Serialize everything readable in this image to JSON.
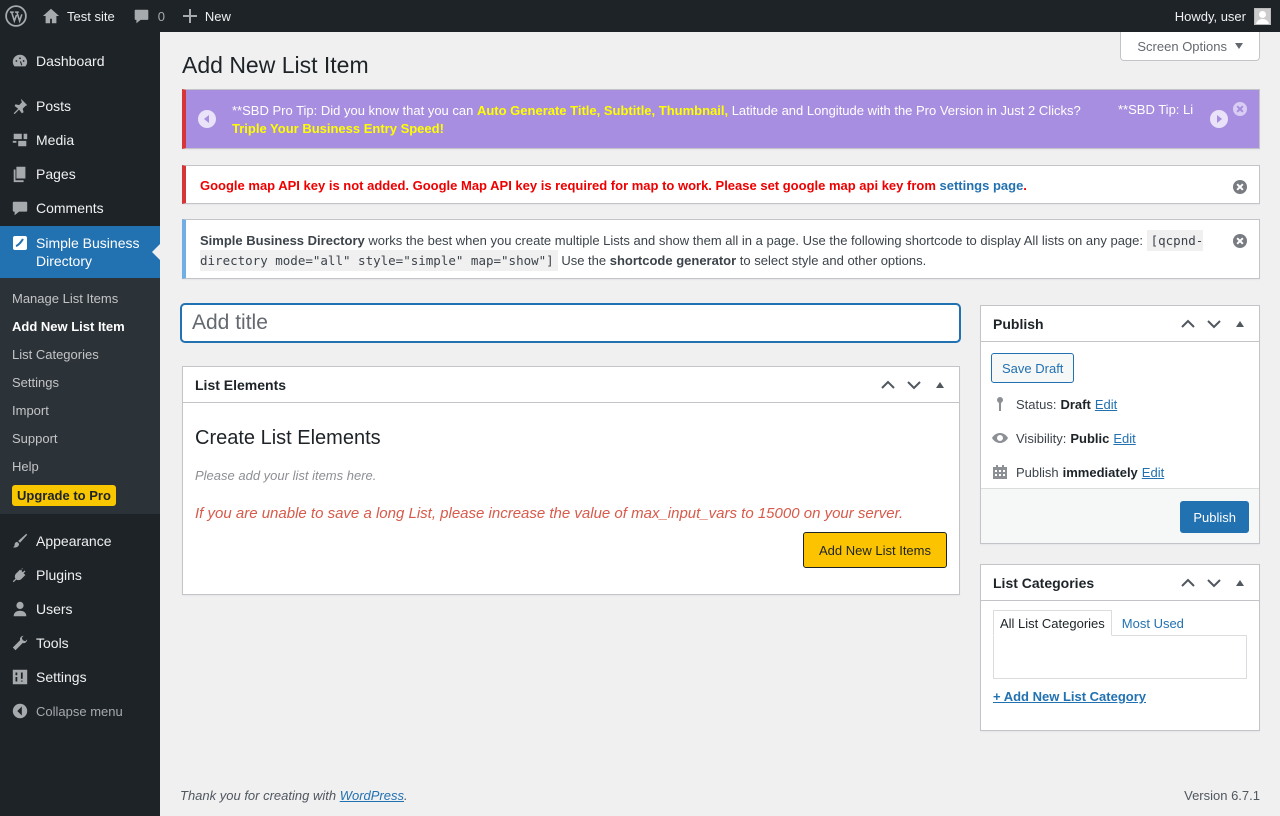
{
  "adminbar": {
    "site_name": "Test site",
    "comments_count": "0",
    "new_label": "New",
    "howdy": "Howdy, user"
  },
  "sidebar": {
    "dashboard": "Dashboard",
    "posts": "Posts",
    "media": "Media",
    "pages": "Pages",
    "comments": "Comments",
    "current": "Simple Business Directory",
    "submenu": [
      "Manage List Items",
      "Add New List Item",
      "List Categories",
      "Settings",
      "Import",
      "Support",
      "Help"
    ],
    "upgrade": "Upgrade to Pro",
    "appearance": "Appearance",
    "plugins": "Plugins",
    "users": "Users",
    "tools": "Tools",
    "settings": "Settings",
    "collapse": "Collapse menu"
  },
  "screen_options": "Screen Options",
  "page_title": "Add New List Item",
  "notices": {
    "tip": {
      "prefix": "**SBD Pro Tip: Did you know that you can ",
      "highlight": "Auto Generate Title, Subtitle, Thumbnail,",
      "middle": " Latitude and Longitude with the Pro Version in Just 2 Clicks?",
      "highlight2": "Triple Your Business Entry Speed!",
      "next": "**SBD Tip: Li"
    },
    "error": {
      "text": "Google map API key is not added. Google Map API key is required for map to work. Please set google map api key from ",
      "link": "settings page",
      "suffix": "."
    },
    "info": {
      "bold1": "Simple Business Directory",
      "text1": " works the best when you create multiple Lists and show them all in a page. Use the following shortcode to display All lists on any page: ",
      "code": "[qcpnd-directory mode=\"all\" style=\"simple\" map=\"show\"]",
      "text2": " Use the ",
      "bold2": "shortcode generator",
      "text3": " to select style and other options."
    }
  },
  "title_placeholder": "Add title",
  "list_elements": {
    "header": "List Elements",
    "heading": "Create List Elements",
    "hint": "Please add your list items here.",
    "warning": "If you are unable to save a long List, please increase the value of max_input_vars to 15000 on your server.",
    "button": "Add New List Items"
  },
  "publish": {
    "header": "Publish",
    "save_draft": "Save Draft",
    "status_label": "Status:",
    "status_value": "Draft",
    "visibility_label": "Visibility:",
    "visibility_value": "Public",
    "publish_label": "Publish",
    "publish_value": "immediately",
    "edit": "Edit",
    "button": "Publish"
  },
  "categories": {
    "header": "List Categories",
    "tab_all": "All List Categories",
    "tab_most": "Most Used",
    "add_new": "+ Add New List Category"
  },
  "footer": {
    "thanks_prefix": "Thank you for creating with ",
    "thanks_link": "WordPress",
    "thanks_suffix": ".",
    "version": "Version 6.7.1"
  },
  "colors": {
    "admin_bg": "#1d2327",
    "accent": "#2271b1",
    "tip_bg": "#a88ee0",
    "error": "#d63638",
    "upgrade": "#f8c700"
  }
}
